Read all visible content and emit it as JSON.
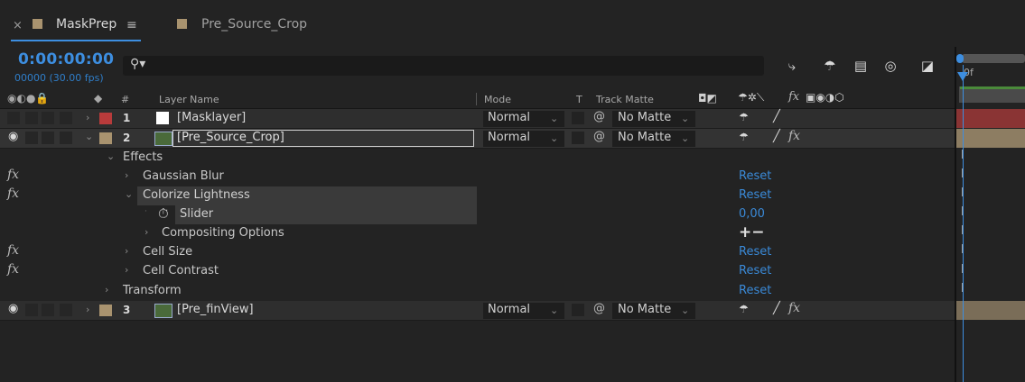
{
  "tabs": [
    {
      "label": "MaskPrep",
      "close": "×",
      "menu": "≡"
    },
    {
      "label": "Pre_Source_Crop"
    }
  ],
  "timecode": "0:00:00:00",
  "fps_text": "00000 (30.00 fps)",
  "search": {
    "placeholder": ""
  },
  "timeline_ruler": "0f",
  "columns": {
    "num": "#",
    "layer_name": "Layer Name",
    "mode": "Mode",
    "t": "T",
    "track_matte": "Track Matte"
  },
  "layers": [
    {
      "num": "1",
      "name": "[Masklayer]",
      "mode": "Normal",
      "matte": "No Matte",
      "label_color": "#b83b3b"
    },
    {
      "num": "2",
      "name": "[Pre_Source_Crop]",
      "mode": "Normal",
      "matte": "No Matte",
      "label_color": "#a9936f"
    },
    {
      "num": "3",
      "name": "[Pre_finView]",
      "mode": "Normal",
      "matte": "No Matte",
      "label_color": "#a9936f"
    }
  ],
  "effects": {
    "group_label": "Effects",
    "gaussian": {
      "label": "Gaussian Blur",
      "reset": "Reset",
      "fx": "fx"
    },
    "colorize": {
      "label": "Colorize Lightness",
      "reset": "Reset",
      "fx": "fx"
    },
    "slider": {
      "label": "Slider",
      "value": "0,00"
    },
    "compositing": {
      "label": "Compositing Options",
      "plusminus": "+−"
    },
    "cell_size": {
      "label": "Cell Size",
      "reset": "Reset",
      "fx": "fx"
    },
    "cell_contrast": {
      "label": "Cell Contrast",
      "reset": "Reset",
      "fx": "fx"
    },
    "transform": {
      "label": "Transform",
      "reset": "Reset"
    }
  },
  "colors": {
    "accent": "#3a8ad8",
    "layer1_bar": "#8a3434",
    "layer_bar": "#8d7d62"
  }
}
